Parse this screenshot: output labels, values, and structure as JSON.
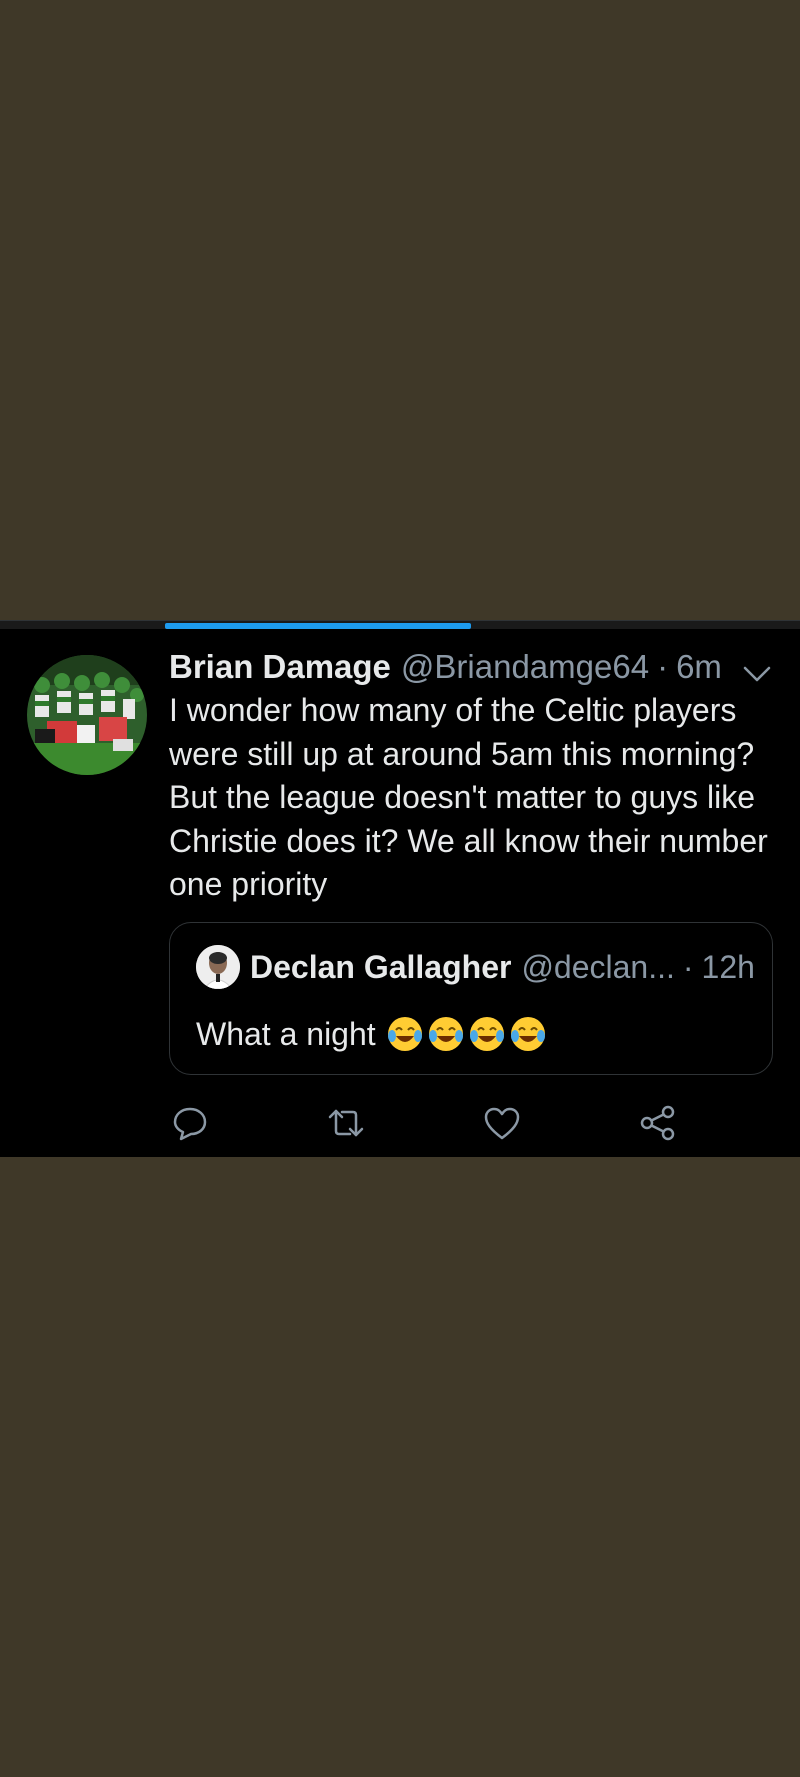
{
  "tweet": {
    "author_name": "Brian Damage",
    "author_handle": "@Briandamge64",
    "separator": "·",
    "timestamp": "6m",
    "text": "I wonder how many of the Celtic players were still up at around 5am this morning? But the league doesn't matter to guys like Christie does it? We all know their number one priority"
  },
  "quoted_tweet": {
    "author_name": "Declan Gallagher",
    "author_handle": "@declan...",
    "separator": "·",
    "timestamp": "12h",
    "text": "What a night",
    "emojis": [
      "face-with-tears-of-joy-icon",
      "face-with-tears-of-joy-icon",
      "face-with-tears-of-joy-icon",
      "face-with-tears-of-joy-icon"
    ]
  },
  "actions": [
    "reply-icon",
    "retweet-icon",
    "like-icon",
    "share-icon"
  ],
  "colors": {
    "background": "#3f3828",
    "card": "#000000",
    "accent": "#1d9bf0",
    "primary_text": "#e7e9ea",
    "secondary_text": "#8b98a5"
  }
}
